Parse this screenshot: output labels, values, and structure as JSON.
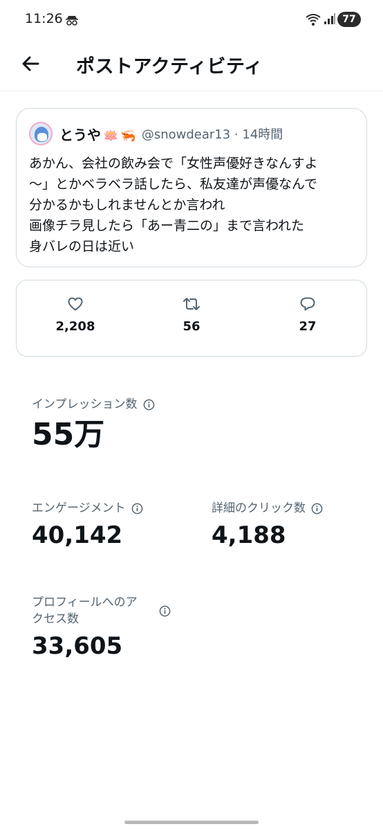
{
  "status_bar": {
    "time": "11:26",
    "battery": "77"
  },
  "header": {
    "title": "ポストアクティビティ"
  },
  "tweet": {
    "author_name": "とうや",
    "handle_and_time": "@snowdear13 · 14時間",
    "text": "あかん、会社の飲み会で「女性声優好きなんすよ\n〜」とかベラベラ話したら、私友達が声優なんで\n分かるかもしれませんとか言われ\n画像チラ見したら「あー青二の」まで言われた\n身バレの日は近い"
  },
  "engagement": {
    "likes": "2,208",
    "retweets": "56",
    "replies": "27"
  },
  "metrics": {
    "impressions_label": "インプレッション数",
    "impressions_value": "55万",
    "engagements_label": "エンゲージメント",
    "engagements_value": "40,142",
    "detail_clicks_label": "詳細のクリック数",
    "detail_clicks_value": "4,188",
    "profile_visits_label_line1": "プロフィールへのア",
    "profile_visits_label_line2": "クセス数",
    "profile_visits_value": "33,605"
  },
  "icons": {
    "back": "arrow-left-icon",
    "like": "heart-icon",
    "retweet": "retweet-icon",
    "reply": "reply-icon",
    "info": "info-icon"
  }
}
